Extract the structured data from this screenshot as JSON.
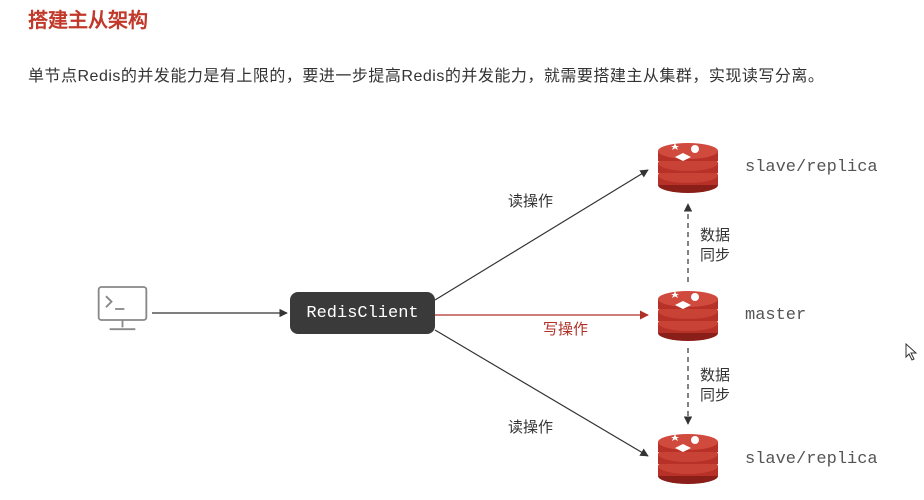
{
  "title": "搭建主从架构",
  "subtitle": "单节点Redis的并发能力是有上限的，要进一步提高Redis的并发能力，就需要搭建主从集群，实现读写分离。",
  "client_label": "RedisClient",
  "nodes": {
    "slave_top": "slave/replica",
    "master": "master",
    "slave_bottom": "slave/replica"
  },
  "edges": {
    "read_top": "读操作",
    "write": "写操作",
    "read_bottom": "读操作",
    "sync_top_1": "数据",
    "sync_top_2": "同步",
    "sync_bottom_1": "数据",
    "sync_bottom_2": "同步"
  },
  "chart_data": {
    "type": "diagram",
    "title": "搭建主从架构",
    "nodes": [
      {
        "id": "terminal",
        "type": "client-terminal"
      },
      {
        "id": "redisclient",
        "type": "component",
        "label": "RedisClient"
      },
      {
        "id": "slave1",
        "type": "redis",
        "label": "slave/replica"
      },
      {
        "id": "master",
        "type": "redis",
        "label": "master"
      },
      {
        "id": "slave2",
        "type": "redis",
        "label": "slave/replica"
      }
    ],
    "edges": [
      {
        "from": "terminal",
        "to": "redisclient",
        "style": "solid"
      },
      {
        "from": "redisclient",
        "to": "slave1",
        "label": "读操作",
        "style": "solid"
      },
      {
        "from": "redisclient",
        "to": "master",
        "label": "写操作",
        "style": "solid",
        "color": "red"
      },
      {
        "from": "redisclient",
        "to": "slave2",
        "label": "读操作",
        "style": "solid"
      },
      {
        "from": "master",
        "to": "slave1",
        "label": "数据同步",
        "style": "dashed"
      },
      {
        "from": "master",
        "to": "slave2",
        "label": "数据同步",
        "style": "dashed"
      }
    ]
  }
}
